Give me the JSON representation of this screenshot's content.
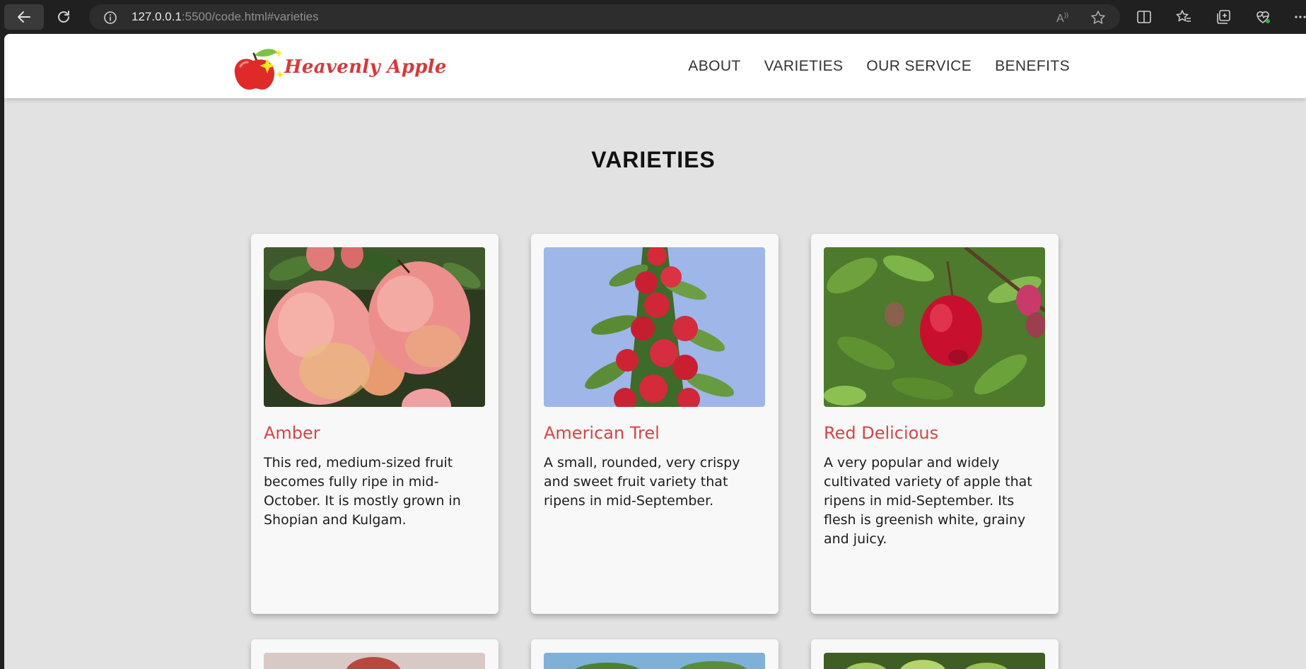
{
  "browser": {
    "url_host": "127.0.0.1",
    "url_rest": ":5500/code.html#varieties"
  },
  "site": {
    "logo_text": "Heavenly Apple",
    "nav": [
      "ABOUT",
      "VARIETIES",
      "OUR SERVICE",
      "BENEFITS"
    ]
  },
  "section": {
    "title": "VARIETIES"
  },
  "cards": [
    {
      "title": "Amber",
      "description": "This red, medium-sized fruit becomes fully ripe in mid-October. It is mostly grown in Shopian and Kulgam."
    },
    {
      "title": "American Trel",
      "description": "A small, rounded, very crispy and sweet fruit variety that ripens in mid-September."
    },
    {
      "title": "Red Delicious",
      "description": "A very popular and widely cultivated variety of apple that ripens in mid-September. Its flesh is greenish white, grainy and juicy."
    }
  ],
  "colors": {
    "accent": "#d64545",
    "page_bg": "#e2e2e2",
    "navbar_bg": "#ffffff",
    "chrome_bg": "#202020"
  }
}
